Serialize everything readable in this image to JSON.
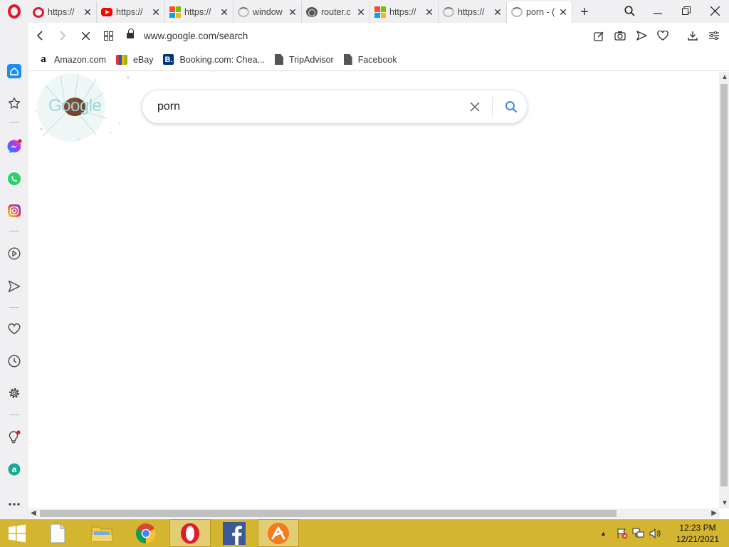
{
  "browser": {
    "tabs": [
      {
        "title": "https://",
        "favicon": "opera-icon",
        "active": false
      },
      {
        "title": "https://",
        "favicon": "youtube-icon",
        "active": false
      },
      {
        "title": "https://",
        "favicon": "microsoft-icon",
        "active": false
      },
      {
        "title": "window",
        "favicon": "loading-icon",
        "active": false
      },
      {
        "title": "router.c",
        "favicon": "globe-icon",
        "active": false
      },
      {
        "title": "https://",
        "favicon": "microsoft-icon",
        "active": false
      },
      {
        "title": "https://",
        "favicon": "loading-icon",
        "active": false
      },
      {
        "title": "porn - (",
        "favicon": "loading-icon",
        "active": true
      }
    ],
    "new_tab": "+",
    "url": "www.google.com/search",
    "bookmarks": [
      {
        "label": "Amazon.com",
        "icon": "amazon-icon"
      },
      {
        "label": "eBay",
        "icon": "ebay-icon"
      },
      {
        "label": "Booking.com: Chea...",
        "icon": "booking-icon"
      },
      {
        "label": "TripAdvisor",
        "icon": "document-icon"
      },
      {
        "label": "Facebook",
        "icon": "document-icon"
      }
    ],
    "sidebar": [
      "home-icon",
      "speed-dial-icon",
      "messenger-icon",
      "whatsapp-icon",
      "instagram-icon",
      "player-icon",
      "send-icon",
      "heart-icon",
      "history-icon",
      "settings-icon",
      "lightbulb-icon",
      "aria-icon",
      "more-icon"
    ]
  },
  "page": {
    "doodle_text": "Google",
    "search_query": "porn"
  },
  "taskbar": {
    "time": "12:23 PM",
    "date": "12/21/2021"
  },
  "colors": {
    "opera_red": "#e2182d",
    "taskbar": "#d4b52f",
    "google_blue": "#4285f4"
  }
}
